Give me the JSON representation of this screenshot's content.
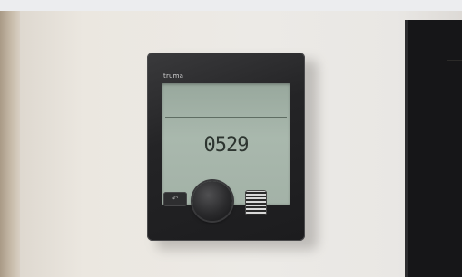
{
  "scene": {
    "description_visible_text": {
      "brand": "truma",
      "display_time": "0529",
      "back_button_symbol": "↶"
    }
  }
}
